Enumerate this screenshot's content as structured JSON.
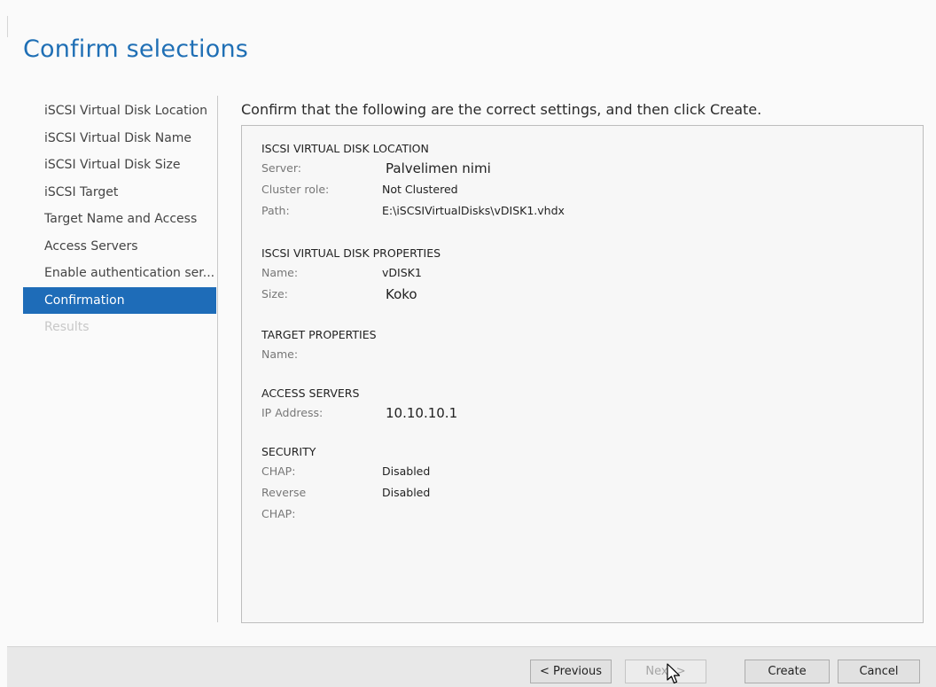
{
  "page": {
    "title": "Confirm selections",
    "instruction": "Confirm that the following are the correct settings, and then click Create."
  },
  "sidebar": {
    "items": [
      {
        "label": "iSCSI Virtual Disk Location"
      },
      {
        "label": "iSCSI Virtual Disk Name"
      },
      {
        "label": "iSCSI Virtual Disk Size"
      },
      {
        "label": "iSCSI Target"
      },
      {
        "label": "Target Name and Access"
      },
      {
        "label": "Access Servers"
      },
      {
        "label": "Enable authentication ser..."
      },
      {
        "label": "Confirmation",
        "active": true
      },
      {
        "label": "Results",
        "disabled": true
      }
    ]
  },
  "summary": {
    "location": {
      "title": "ISCSI VIRTUAL DISK LOCATION",
      "server_label": "Server:",
      "server_value": "Palvelimen nimi",
      "cluster_label": "Cluster role:",
      "cluster_value": "Not Clustered",
      "path_label": "Path:",
      "path_value": "E:\\iSCSIVirtualDisks\\vDISK1.vhdx"
    },
    "properties": {
      "title": "ISCSI VIRTUAL DISK PROPERTIES",
      "name_label": "Name:",
      "name_value": "vDISK1",
      "size_label": "Size:",
      "size_value": "Koko"
    },
    "target": {
      "title": "TARGET PROPERTIES",
      "name_label": "Name:",
      "name_value": ""
    },
    "access": {
      "title": "ACCESS SERVERS",
      "ip_label": "IP Address:",
      "ip_value": "10.10.10.1"
    },
    "security": {
      "title": "SECURITY",
      "chap_label": "CHAP:",
      "chap_value": "Disabled",
      "rchap_label": "Reverse CHAP:",
      "rchap_value": "Disabled"
    }
  },
  "footer": {
    "previous": "< Previous",
    "next": "Next >",
    "create": "Create",
    "cancel": "Cancel"
  },
  "colors": {
    "accent": "#1e6cb8",
    "title": "#1f6fb5"
  }
}
